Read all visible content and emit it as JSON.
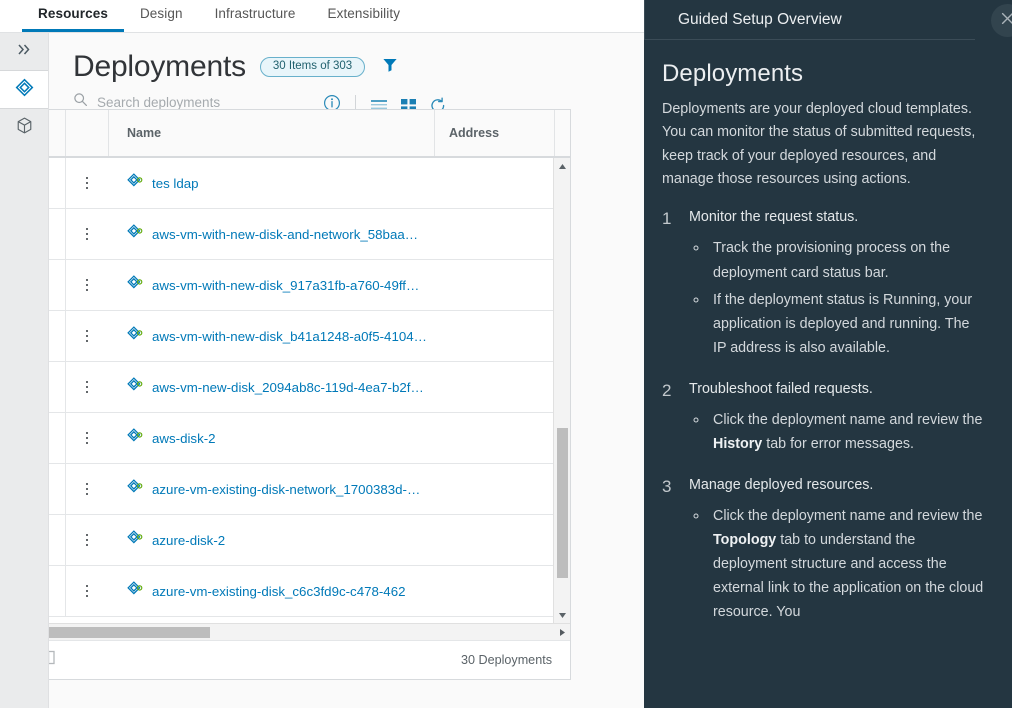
{
  "tabs": [
    {
      "label": "Resources",
      "active": true
    },
    {
      "label": "Design",
      "active": false
    },
    {
      "label": "Infrastructure",
      "active": false
    },
    {
      "label": "Extensibility",
      "active": false
    }
  ],
  "rail": [
    {
      "name": "expand-rail",
      "icon": "double-chevron-right-icon"
    },
    {
      "name": "deployments",
      "icon": "deployment-diamond-icon",
      "active": true
    },
    {
      "name": "resources",
      "icon": "cube-icon",
      "active": false
    }
  ],
  "page": {
    "title": "Deployments",
    "count_badge": "30 Items of 303",
    "filter_icon": "funnel-icon"
  },
  "search": {
    "placeholder": "Search deployments",
    "value": "",
    "icon": "search-icon"
  },
  "toolbar": {
    "info_icon": "info-circle-icon",
    "list_view_icon": "list-view-icon",
    "card_view_icon": "card-view-icon",
    "refresh_icon": "refresh-icon"
  },
  "grid": {
    "columns": [
      "",
      "",
      "Name",
      "Address",
      ""
    ],
    "column_name": "Name",
    "column_address": "Address",
    "rows": [
      {
        "name": "tes ldap",
        "address": ""
      },
      {
        "name": "aws-vm-with-new-disk-and-network_58baa…",
        "address": ""
      },
      {
        "name": "aws-vm-with-new-disk_917a31fb-a760-49ff…",
        "address": ""
      },
      {
        "name": "aws-vm-with-new-disk_b41a1248-a0f5-4104…",
        "address": ""
      },
      {
        "name": "aws-vm-new-disk_2094ab8c-119d-4ea7-b2f…",
        "address": ""
      },
      {
        "name": "aws-disk-2",
        "address": ""
      },
      {
        "name": "azure-vm-existing-disk-network_1700383d-…",
        "address": ""
      },
      {
        "name": "azure-disk-2",
        "address": ""
      },
      {
        "name": "azure-vm-existing-disk_c6c3fd9c-c478-462",
        "address": ""
      }
    ],
    "footer_count": "30 Deployments",
    "column_picker_icon": "column-picker-icon"
  },
  "panel": {
    "title": "Guided Setup Overview",
    "close_icon": "close-icon",
    "heading": "Deployments",
    "intro": "Deployments are your deployed cloud templates. You can monitor the status of submitted requests, keep track of your deployed resources, and manage those resources using actions.",
    "steps": [
      {
        "num": "1",
        "title": "Monitor the request status.",
        "bullets": [
          {
            "pre": "Track the provisioning process on the deployment card status bar.",
            "bold": "",
            "post": ""
          },
          {
            "pre": "If the deployment status is Running, your application is deployed and running. The IP address is also available.",
            "bold": "",
            "post": ""
          }
        ]
      },
      {
        "num": "2",
        "title": "Troubleshoot failed requests.",
        "bullets": [
          {
            "pre": "Click the deployment name and review the ",
            "bold": "History",
            "post": " tab for error messages."
          }
        ]
      },
      {
        "num": "3",
        "title": "Manage deployed resources.",
        "bullets": [
          {
            "pre": "Click the deployment name and review the ",
            "bold": "Topology",
            "post": " tab to understand the deployment structure and access the external link to the application on the cloud resource. You"
          }
        ]
      }
    ]
  },
  "colors": {
    "accent": "#0079b8",
    "panel_bg": "#243641",
    "badge_bg": "#e8f5fa",
    "link": "#0079b8"
  }
}
